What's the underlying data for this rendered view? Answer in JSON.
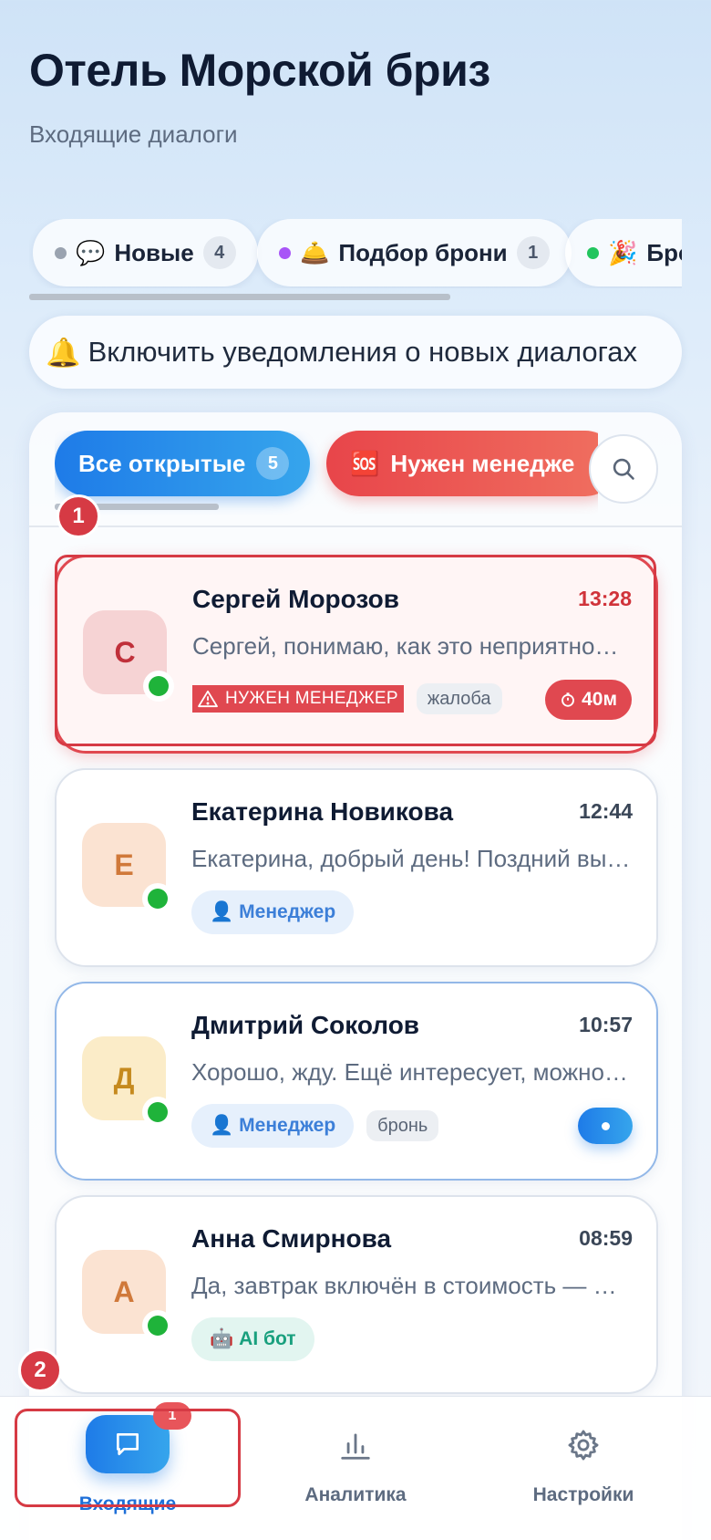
{
  "header": {
    "title": "Отель Морской бриз",
    "subtitle": "Входящие диалоги"
  },
  "status_tabs": [
    {
      "emoji": "💬",
      "label": "Новые",
      "count": "4",
      "dot_color": "#9aa3b0"
    },
    {
      "emoji": "🛎️",
      "label": "Подбор брони",
      "count": "1",
      "dot_color": "#a855f7"
    },
    {
      "emoji": "🎉",
      "label": "Бро",
      "count": "",
      "dot_color": "#22c55e"
    }
  ],
  "notify_button": {
    "icon": "🔔",
    "label": "Включить уведомления о новых диалогах"
  },
  "filters": {
    "all": {
      "label": "Все открытые",
      "count": "5"
    },
    "manager": {
      "icon": "🆘",
      "label": "Нужен менедже"
    }
  },
  "conversations": [
    {
      "initial": "С",
      "name": "Сергей Морозов",
      "time": "13:28",
      "preview": "Сергей, понимаю, как это неприятно…",
      "flag": "НУЖЕН МЕНЕДЖЕР",
      "topic": "жалоба",
      "wait": "40м",
      "avatar_bg": "#f6d3d4",
      "avatar_fg": "#c0303a"
    },
    {
      "initial": "Е",
      "name": "Екатерина Новикова",
      "time": "12:44",
      "preview": "Екатерина, добрый день! Поздний выезд…",
      "role": "Менеджер",
      "role_icon": "👤",
      "avatar_bg": "#fbe3d2",
      "avatar_fg": "#d0793a"
    },
    {
      "initial": "Д",
      "name": "Дмитрий Соколов",
      "time": "10:57",
      "preview": "Хорошо, жду. Ещё интересует, можно…",
      "role": "Менеджер",
      "role_icon": "👤",
      "topic": "бронь",
      "avatar_bg": "#fbecc8",
      "avatar_fg": "#c58a1e"
    },
    {
      "initial": "А",
      "name": "Анна Смирнова",
      "time": "08:59",
      "preview": "Да, завтрак включён в стоимость — …",
      "role": "AI бот",
      "role_icon": "🤖",
      "avatar_bg": "#fbe3d2",
      "avatar_fg": "#d0793a"
    }
  ],
  "annotations": {
    "one": "1",
    "two": "2"
  },
  "bottom_nav": {
    "inbox": {
      "label": "Входящие",
      "badge": "1",
      "icon": "chat-icon"
    },
    "analytics": {
      "label": "Аналитика",
      "icon": "bar-chart-icon"
    },
    "settings": {
      "label": "Настройки",
      "icon": "gear-icon"
    }
  }
}
